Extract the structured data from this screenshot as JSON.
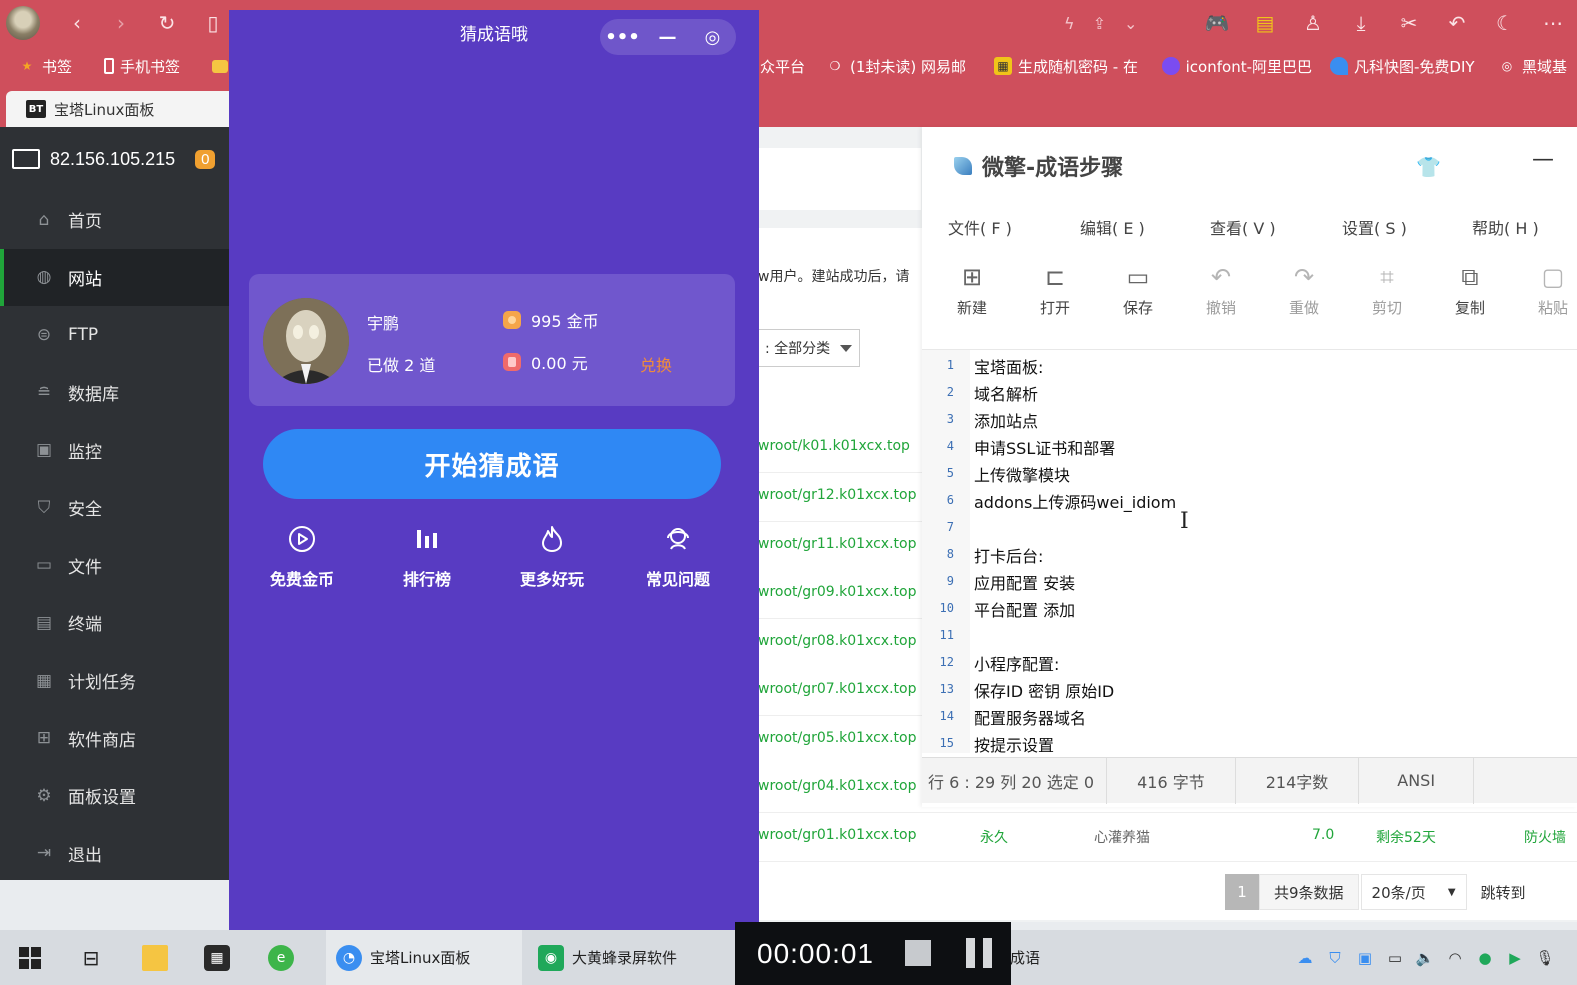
{
  "browser": {
    "bookmarks": [
      {
        "label": "书签",
        "icon": "star-icon",
        "color": "#f5a623"
      },
      {
        "label": "手机书签",
        "icon": "phone-icon",
        "color": "#ffffff"
      },
      {
        "label": "众平台",
        "icon": "",
        "color": ""
      },
      {
        "label": "(1封未读) 网易邮",
        "icon": "mail-icon",
        "color": "#ffffff"
      },
      {
        "label": "生成随机密码 - 在",
        "icon": "key-icon",
        "color": "#f0c419"
      },
      {
        "label": "iconfont-阿里巴巴",
        "icon": "iconfont-icon",
        "color": "#7b4cf0"
      },
      {
        "label": "凡科快图-免费DIY",
        "icon": "fk-icon",
        "color": "#3a8ef0"
      },
      {
        "label": "黑域基",
        "icon": "spiral-icon",
        "color": "#ffffff"
      }
    ],
    "tab_title": "宝塔Linux面板",
    "tab_badge": "BT"
  },
  "bt_panel": {
    "ip": "82.156.105.215",
    "badge": "0",
    "nav": [
      {
        "label": "首页",
        "icon": "home-icon"
      },
      {
        "label": "网站",
        "icon": "globe-icon",
        "active": true
      },
      {
        "label": "FTP",
        "icon": "ftp-icon"
      },
      {
        "label": "数据库",
        "icon": "database-icon"
      },
      {
        "label": "监控",
        "icon": "monitor-icon"
      },
      {
        "label": "安全",
        "icon": "shield-icon"
      },
      {
        "label": "文件",
        "icon": "folder-icon"
      },
      {
        "label": "终端",
        "icon": "terminal-icon"
      },
      {
        "label": "计划任务",
        "icon": "calendar-icon"
      },
      {
        "label": "软件商店",
        "icon": "apps-icon"
      },
      {
        "label": "面板设置",
        "icon": "gear-icon"
      },
      {
        "label": "退出",
        "icon": "logout-icon"
      }
    ],
    "notice_fragment": "w用户。建站成功后，请",
    "category_select": ": 全部分类",
    "sites": [
      {
        "path": "wroot/k01.k01xcx.top"
      },
      {
        "path": "wroot/gr12.k01xcx.top"
      },
      {
        "path": "wroot/gr11.k01xcx.top"
      },
      {
        "path": "wroot/gr09.k01xcx.top"
      },
      {
        "path": "wroot/gr08.k01xcx.top"
      },
      {
        "path": "wroot/gr07.k01xcx.top"
      },
      {
        "path": "wroot/gr05.k01xcx.top"
      },
      {
        "path": "wroot/gr04.k01xcx.top"
      },
      {
        "path": "wroot/gr01.k01xcx.top",
        "expire": "永久",
        "remark": "心灌养猫",
        "php": "7.0",
        "ssl": "剩余52天",
        "firewall": "防火墙"
      }
    ],
    "pager": {
      "current": "1",
      "total": "共9条数据",
      "size": "20条/页",
      "jump": "跳转到"
    }
  },
  "editor": {
    "title": "微擎-成语步骤",
    "menu": [
      "文件( F )",
      "编辑( E )",
      "查看( V )",
      "设置( S )",
      "帮助( H )"
    ],
    "tools": [
      {
        "label": "新建",
        "icon": "new-file-icon",
        "enabled": true
      },
      {
        "label": "打开",
        "icon": "open-folder-icon",
        "enabled": true
      },
      {
        "label": "保存",
        "icon": "save-icon",
        "enabled": true
      },
      {
        "label": "撤销",
        "icon": "undo-icon",
        "enabled": false
      },
      {
        "label": "重做",
        "icon": "redo-icon",
        "enabled": false
      },
      {
        "label": "剪切",
        "icon": "cut-icon",
        "enabled": false
      },
      {
        "label": "复制",
        "icon": "copy-icon",
        "enabled": true
      },
      {
        "label": "粘贴",
        "icon": "paste-icon",
        "enabled": false
      }
    ],
    "lines": [
      {
        "n": "1",
        "text": "宝塔面板:"
      },
      {
        "n": "2",
        "text": "域名解析"
      },
      {
        "n": "3",
        "text": "添加站点"
      },
      {
        "n": "4",
        "text": "申请SSL证书和部署"
      },
      {
        "n": "5",
        "text": "上传微擎模块"
      },
      {
        "n": "6",
        "text": "addons上传源码wei_idiom"
      },
      {
        "n": "7",
        "text": ""
      },
      {
        "n": "8",
        "text": "打卡后台:"
      },
      {
        "n": "9",
        "text": "应用配置 安装"
      },
      {
        "n": "10",
        "text": "平台配置 添加"
      },
      {
        "n": "11",
        "text": ""
      },
      {
        "n": "12",
        "text": "小程序配置:"
      },
      {
        "n": "13",
        "text": "保存ID 密钥 原始ID"
      },
      {
        "n": "14",
        "text": "配置服务器域名"
      },
      {
        "n": "15",
        "text": "按提示设置"
      }
    ],
    "status": {
      "position": "行 6 : 29   列 20   选定 0",
      "bytes": "416 字节",
      "chars": "214字数",
      "encoding": "ANSI"
    }
  },
  "mini_program": {
    "title": "猜成语哦",
    "capsule": {
      "more": "•••",
      "minimize": "—",
      "close": "◎"
    },
    "user": {
      "name": "宇鹏",
      "done": "已做 2 道",
      "coins": "995 金币",
      "money": "0.00 元",
      "exchange": "兑换"
    },
    "start_button": "开始猜成语",
    "entries": [
      {
        "label": "免费金币",
        "icon": "play-circle-icon"
      },
      {
        "label": "排行榜",
        "icon": "bar-chart-icon"
      },
      {
        "label": "更多好玩",
        "icon": "flame-icon"
      },
      {
        "label": "常见问题",
        "icon": "support-icon"
      }
    ],
    "bg_color": "#583bc2",
    "button_color": "#2f88f4"
  },
  "taskbar": {
    "items": [
      {
        "label": "",
        "icon": "windows-icon"
      },
      {
        "label": "",
        "icon": "task-view-icon"
      },
      {
        "label": "",
        "icon": "file-explorer-icon"
      },
      {
        "label": "",
        "icon": "store-icon"
      },
      {
        "label": "",
        "icon": "browser-e-icon"
      },
      {
        "label": "宝塔Linux面板",
        "icon": "browser-icon"
      },
      {
        "label": "大黄蜂录屏软件",
        "icon": "recorder-icon"
      },
      {
        "label": "成语",
        "icon": ""
      }
    ],
    "recorder_time": "00:00:01"
  }
}
